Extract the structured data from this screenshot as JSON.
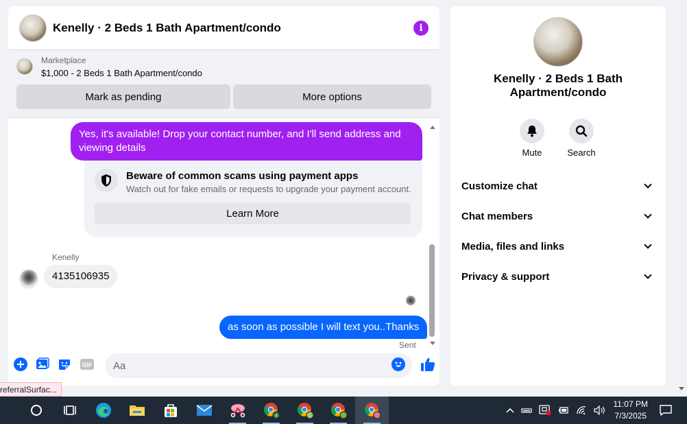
{
  "chat": {
    "title": "Kenelly · 2 Beds 1 Bath Apartment/condo",
    "marketplace_label": "Marketplace",
    "listing": "$1,000 - 2 Beds 1 Bath Apartment/condo",
    "mark_pending_label": "Mark as pending",
    "more_options_label": "More options",
    "messages": {
      "outgoing_1": "Yes, it's available! Drop your contact number, and I'll send address and viewing details",
      "warning_title": "Beware of common scams using payment apps",
      "warning_sub": "Watch out for fake emails or requests to upgrade your payment account.",
      "learn_more_label": "Learn More",
      "sender_name": "Kenelly",
      "incoming_1": "4135106935",
      "outgoing_2": "as soon as possible I will text you..Thanks",
      "sent_status": "Sent"
    },
    "composer": {
      "placeholder": "Aa",
      "gif_label": "GIF"
    },
    "accent_color": "#a020f0",
    "outgoing_color": "#0866ff"
  },
  "info_panel": {
    "title": "Kenelly · 2 Beds 1 Bath Apartment/condo",
    "actions": [
      {
        "label": "Mute",
        "icon": "bell-icon"
      },
      {
        "label": "Search",
        "icon": "search-icon"
      }
    ],
    "sections": [
      {
        "label": "Customize chat"
      },
      {
        "label": "Chat members"
      },
      {
        "label": "Media, files and links"
      },
      {
        "label": "Privacy & support"
      }
    ]
  },
  "status_tooltip": "referralSurfac...",
  "taskbar": {
    "time": "11:07 PM",
    "date": "7/3/2025"
  }
}
